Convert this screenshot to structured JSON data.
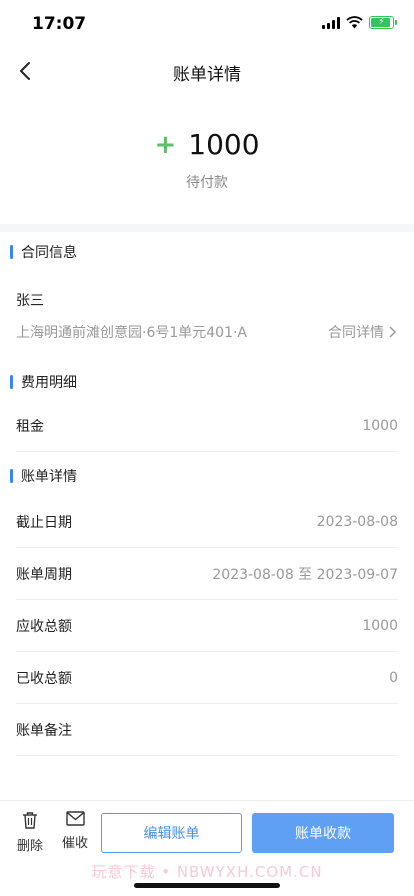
{
  "status_bar": {
    "time": "17:07"
  },
  "nav": {
    "title": "账单详情"
  },
  "amount": {
    "sign": "+",
    "value": "1000",
    "status": "待付款"
  },
  "contract_info": {
    "section_title": "合同信息",
    "tenant": "张三",
    "address": "上海明通前滩创意园·6号1单元401·A",
    "link_label": "合同详情"
  },
  "fee_detail": {
    "section_title": "费用明细",
    "items": [
      {
        "label": "租金",
        "value": "1000"
      }
    ]
  },
  "bill_detail": {
    "section_title": "账单详情",
    "rows": [
      {
        "label": "截止日期",
        "value": "2023-08-08"
      },
      {
        "label": "账单周期",
        "value": "2023-08-08 至 2023-09-07"
      },
      {
        "label": "应收总额",
        "value": "1000"
      },
      {
        "label": "已收总额",
        "value": "0"
      },
      {
        "label": "账单备注",
        "value": ""
      }
    ]
  },
  "bottom": {
    "delete_label": "删除",
    "remind_label": "催收",
    "edit_label": "编辑账单",
    "collect_label": "账单收款",
    "watermark": "玩意下载 • NBWYXH.COM.CN"
  },
  "colors": {
    "accent": "#5fa0f5",
    "positive": "#5cc06a",
    "section_marker": "#3b82f6"
  },
  "icons": [
    "back-icon",
    "signal-icon",
    "wifi-icon",
    "battery-icon",
    "chevron-right-icon",
    "trash-icon",
    "envelope-icon"
  ]
}
